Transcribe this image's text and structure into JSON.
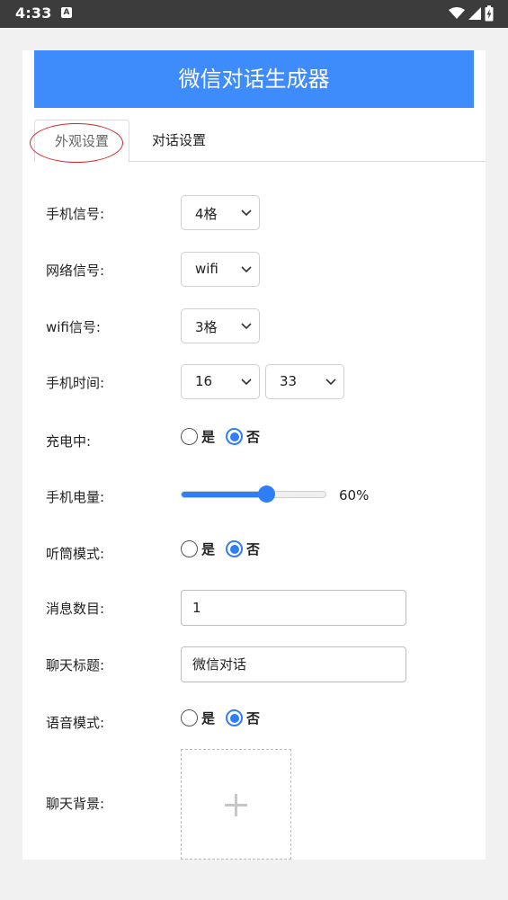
{
  "status_bar": {
    "time": "4:33",
    "notification_icon": "a-icon",
    "icons": [
      "wifi-icon",
      "cell-signal-icon",
      "battery-charging-icon"
    ]
  },
  "app": {
    "title": "微信对话生成器"
  },
  "tabs": [
    {
      "label": "外观设置",
      "active": true
    },
    {
      "label": "对话设置",
      "active": false
    }
  ],
  "form": {
    "phone_signal": {
      "label": "手机信号:",
      "value": "4格"
    },
    "network_signal": {
      "label": "网络信号:",
      "value": "wifi"
    },
    "wifi_signal": {
      "label": "wifi信号:",
      "value": "3格"
    },
    "phone_time": {
      "label": "手机时间:",
      "hour": "16",
      "minute": "33"
    },
    "charging": {
      "label": "充电中:",
      "options": [
        "是",
        "否"
      ],
      "selected": "否"
    },
    "battery": {
      "label": "手机电量:",
      "value": "60%",
      "percent": 60
    },
    "earpiece_mode": {
      "label": "听筒模式:",
      "options": [
        "是",
        "否"
      ],
      "selected": "否"
    },
    "message_count": {
      "label": "消息数目:",
      "value": "1"
    },
    "chat_title": {
      "label": "聊天标题:",
      "value": "微信对话"
    },
    "voice_mode": {
      "label": "语音模式:",
      "options": [
        "是",
        "否"
      ],
      "selected": "否"
    },
    "chat_background": {
      "label": "聊天背景:",
      "upload_icon": "plus-icon"
    }
  },
  "colors": {
    "header_blue": "#3e8bfb",
    "accent_blue": "#2f7ef5",
    "annotation_red": "#d2282e"
  }
}
